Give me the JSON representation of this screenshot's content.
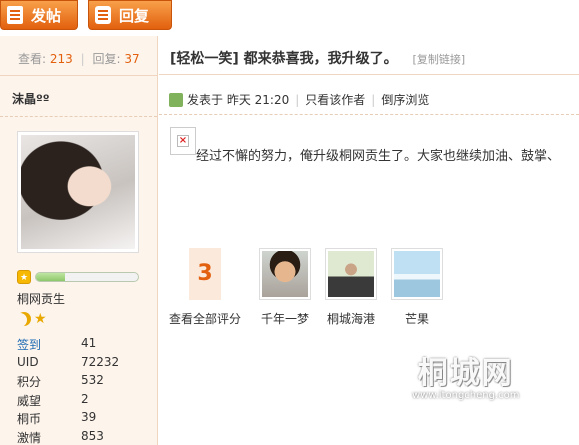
{
  "toolbar": {
    "post_label": "发帖",
    "reply_label": "回复"
  },
  "stats": {
    "views_label": "查看:",
    "views": "213",
    "replies_label": "回复:",
    "replies": "37"
  },
  "author": {
    "name": "沫晶ºº",
    "rank": "桐网贡生",
    "level_fill": 0.28,
    "info": [
      {
        "k": "签到",
        "v": "41",
        "link": true
      },
      {
        "k": "UID",
        "v": "72232"
      },
      {
        "k": "积分",
        "v": "532"
      },
      {
        "k": "威望",
        "v": "2"
      },
      {
        "k": "桐币",
        "v": "39"
      },
      {
        "k": "激情",
        "v": "853"
      }
    ]
  },
  "post": {
    "title": "[轻松一笑] 都来恭喜我，我升级了。",
    "copy_link": "[复制链接]",
    "posted_at": "发表于  昨天 21:20",
    "only_author": "只看该作者",
    "reverse": "倒序浏览",
    "body": "经过不懈的努力，俺升级桐网贡生了。大家也继续加油、鼓掌、"
  },
  "ratings": {
    "score": "3",
    "view_all": "查看全部评分",
    "raters": [
      "千年一梦",
      "桐城海港",
      "芒果"
    ]
  },
  "watermark": {
    "logo": "桐城网",
    "url": "www.itongcheng.com"
  }
}
